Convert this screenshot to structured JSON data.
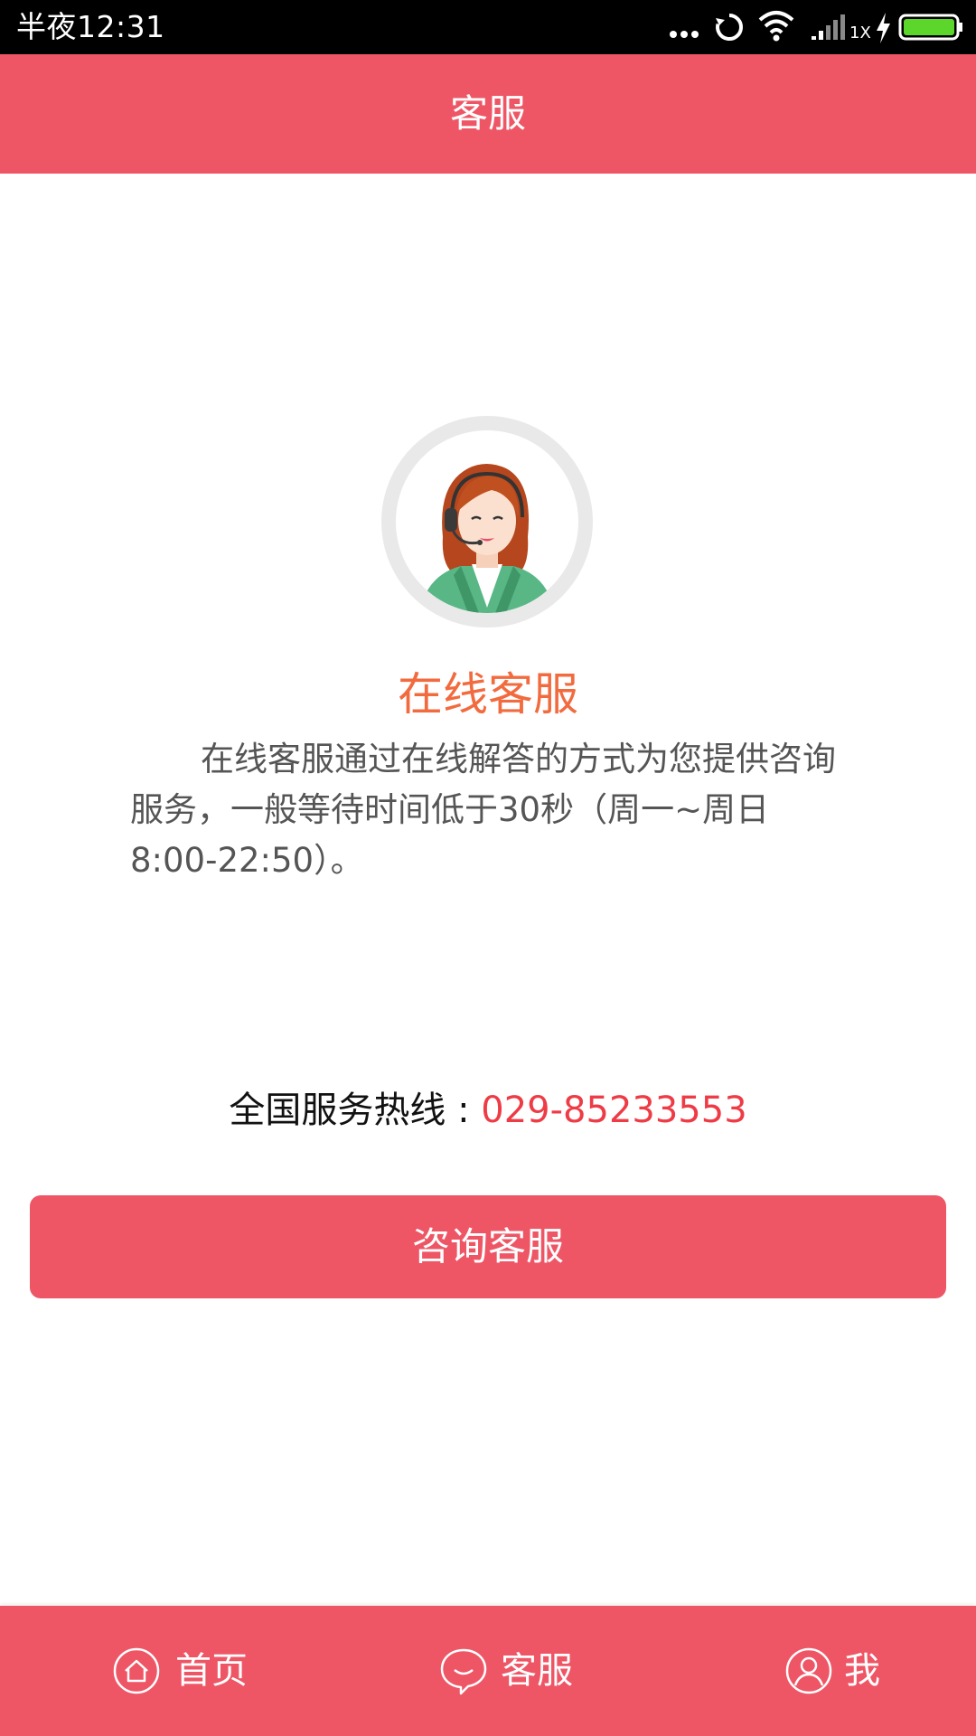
{
  "status_bar": {
    "time": "半夜12:31",
    "network_label": "1X",
    "icons": [
      "more-dots-icon",
      "sync-icon",
      "wifi-icon",
      "signal-icon",
      "charging-icon",
      "battery-icon"
    ]
  },
  "header": {
    "title": "客服"
  },
  "service": {
    "title": "在线客服",
    "description": "在线客服通过在线解答的方式为您提供咨询服务，一般等待时间低于30秒（周一~周日8:00-22:50）。",
    "hotline_label": "全国服务热线 : ",
    "hotline_number": "029-85233553",
    "button_label": "咨询客服"
  },
  "bottom_nav": {
    "items": [
      {
        "label": "首页",
        "icon": "home-icon"
      },
      {
        "label": "客服",
        "icon": "chat-bubble-icon"
      },
      {
        "label": "我",
        "icon": "user-icon"
      }
    ]
  },
  "colors": {
    "accent": "#ee5666",
    "service_title": "#f26b3f",
    "hotline_number": "#ee3b45",
    "battery": "#5cd62b"
  }
}
